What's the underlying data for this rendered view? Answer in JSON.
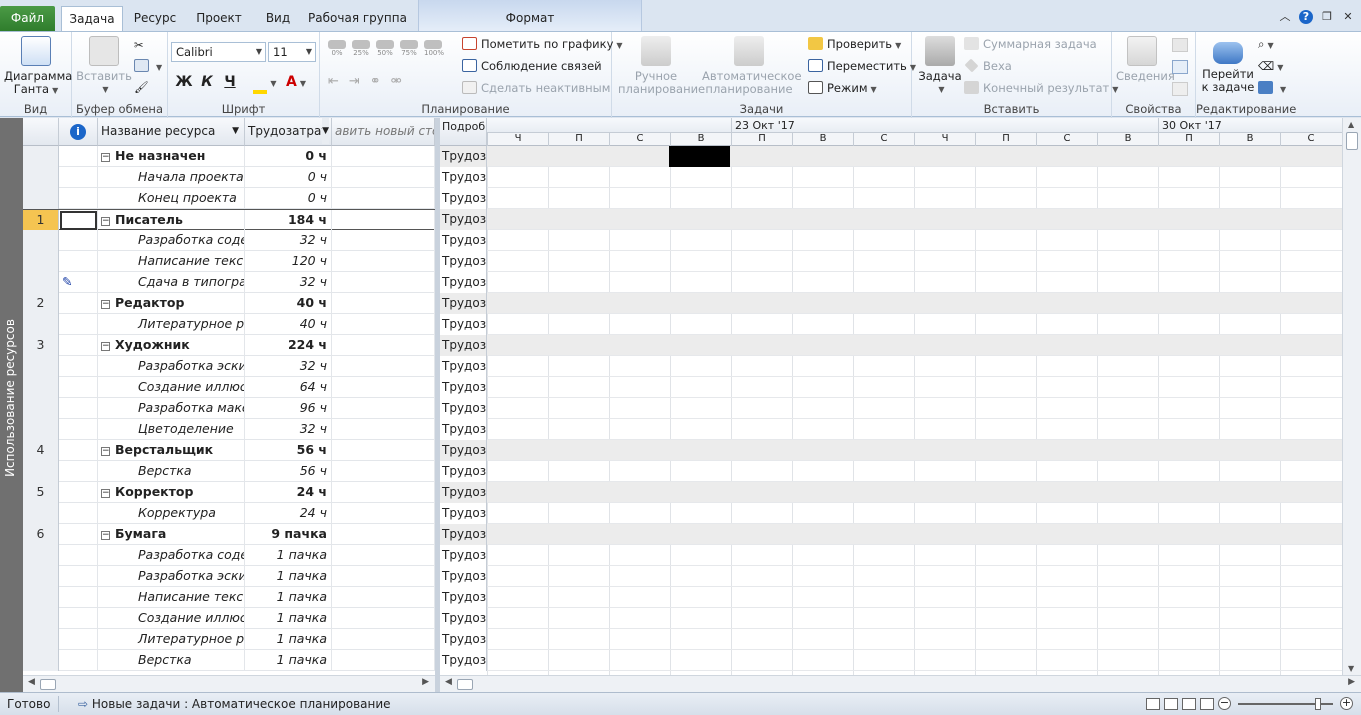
{
  "tabs": {
    "file": "Файл",
    "items": [
      "Задача",
      "Ресурс",
      "Проект",
      "Вид",
      "Рабочая группа"
    ],
    "active": "Задача",
    "contextual": "Формат"
  },
  "ribbon": {
    "view": {
      "gantt_label_1": "Диаграмма",
      "gantt_label_2": "Ганта",
      "group": "Вид"
    },
    "clipboard": {
      "paste": "Вставить",
      "group": "Буфер обмена"
    },
    "font": {
      "family": "Calibri",
      "size": "11",
      "bold": "Ж",
      "italic": "К",
      "underline": "Ч",
      "group": "Шрифт"
    },
    "schedule": {
      "percent": [
        "0%",
        "25%",
        "50%",
        "75%",
        "100%"
      ],
      "mark_on_track": "Пометить по графику",
      "respect_links": "Соблюдение связей",
      "inactivate": "Сделать неактивным",
      "group": "Планирование"
    },
    "tasks": {
      "manual_1": "Ручное",
      "manual_2": "планирование",
      "auto_1": "Автоматическое",
      "auto_2": "планирование",
      "inspect": "Проверить",
      "move": "Переместить",
      "mode": "Режим",
      "group": "Задачи"
    },
    "insert": {
      "task": "Задача",
      "summary": "Суммарная задача",
      "milestone": "Веха",
      "deliverable": "Конечный результат",
      "group": "Вставить"
    },
    "properties": {
      "info": "Сведения",
      "group": "Свойства"
    },
    "editing": {
      "scroll_1": "Перейти",
      "scroll_2": "к задаче",
      "group": "Редактирование"
    }
  },
  "view_band": "Использование ресурсов",
  "grid": {
    "headers": {
      "info_icon": "i",
      "name": "Название ресурса",
      "work": "Трудозатрат",
      "add_column": "авить новый сто"
    },
    "rows": [
      {
        "id": "",
        "name": "Не назначен",
        "work": "0 ч",
        "type": "group"
      },
      {
        "id": "",
        "name": "Начала проекта",
        "work": "0 ч",
        "type": "sub"
      },
      {
        "id": "",
        "name": "Конец проекта",
        "work": "0 ч",
        "type": "sub"
      },
      {
        "id": "1",
        "name": "Писатель",
        "work": "184 ч",
        "type": "group",
        "selected": true
      },
      {
        "id": "",
        "name": "Разработка содержания",
        "work": "32 ч",
        "type": "sub"
      },
      {
        "id": "",
        "name": "Написание текста",
        "work": "120 ч",
        "type": "sub"
      },
      {
        "id": "",
        "name": "Сдача в типографию",
        "work": "32 ч",
        "type": "sub",
        "indicator": true
      },
      {
        "id": "2",
        "name": "Редактор",
        "work": "40 ч",
        "type": "group"
      },
      {
        "id": "",
        "name": "Литературное редактирование",
        "work": "40 ч",
        "type": "sub"
      },
      {
        "id": "3",
        "name": "Художник",
        "work": "224 ч",
        "type": "group"
      },
      {
        "id": "",
        "name": "Разработка эскизов",
        "work": "32 ч",
        "type": "sub"
      },
      {
        "id": "",
        "name": "Создание иллюстраций",
        "work": "64 ч",
        "type": "sub"
      },
      {
        "id": "",
        "name": "Разработка макета",
        "work": "96 ч",
        "type": "sub"
      },
      {
        "id": "",
        "name": "Цветоделение",
        "work": "32 ч",
        "type": "sub"
      },
      {
        "id": "4",
        "name": "Верстальщик",
        "work": "56 ч",
        "type": "group"
      },
      {
        "id": "",
        "name": "Верстка",
        "work": "56 ч",
        "type": "sub"
      },
      {
        "id": "5",
        "name": "Корректор",
        "work": "24 ч",
        "type": "group"
      },
      {
        "id": "",
        "name": "Корректура",
        "work": "24 ч",
        "type": "sub"
      },
      {
        "id": "6",
        "name": "Бумага",
        "work": "9 пачка",
        "type": "group"
      },
      {
        "id": "",
        "name": "Разработка содержания",
        "work": "1 пачка",
        "type": "sub"
      },
      {
        "id": "",
        "name": "Разработка эскизов",
        "work": "1 пачка",
        "type": "sub"
      },
      {
        "id": "",
        "name": "Написание текста",
        "work": "1 пачка",
        "type": "sub"
      },
      {
        "id": "",
        "name": "Создание иллюстраций",
        "work": "1 пачка",
        "type": "sub"
      },
      {
        "id": "",
        "name": "Литературное редактирование",
        "work": "1 пачка",
        "type": "sub"
      },
      {
        "id": "",
        "name": "Верстка",
        "work": "1 пачка",
        "type": "sub"
      }
    ]
  },
  "timescale": {
    "details_header": "Подроб",
    "weeks": [
      "23 Окт '17",
      "30 Окт '17"
    ],
    "days": [
      "Ч",
      "П",
      "С",
      "В",
      "П",
      "В",
      "С",
      "Ч",
      "П",
      "С",
      "В",
      "П",
      "В",
      "С"
    ],
    "row_label": "Трудоз"
  },
  "status": {
    "ready": "Готово",
    "new_tasks": "Новые задачи : Автоматическое планирование"
  },
  "colors": {
    "file_tab": "#2f7d2c",
    "selected_id": "#f5c451",
    "info_icon": "#1b66c9"
  }
}
